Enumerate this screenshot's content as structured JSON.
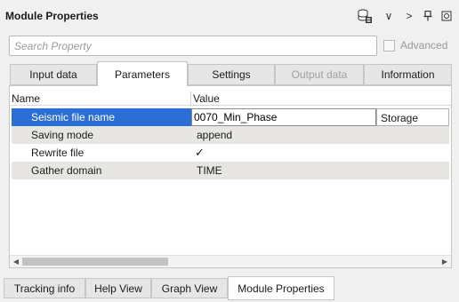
{
  "window": {
    "title": "Module Properties"
  },
  "toolbar": {
    "icons": [
      "database-icon",
      "chevron-down-icon",
      "chevron-right-icon",
      "pin-icon",
      "close-icon"
    ],
    "chevron_down": "∨",
    "chevron_right": ">",
    "pin": "⌇"
  },
  "search": {
    "placeholder": "Search Property"
  },
  "advanced": {
    "label": "Advanced",
    "checked": false
  },
  "tabs": [
    {
      "label": "Input data",
      "active": false,
      "disabled": false
    },
    {
      "label": "Parameters",
      "active": true,
      "disabled": false
    },
    {
      "label": "Settings",
      "active": false,
      "disabled": false
    },
    {
      "label": "Output data",
      "active": false,
      "disabled": true
    },
    {
      "label": "Information",
      "active": false,
      "disabled": false
    }
  ],
  "grid": {
    "columns": [
      "Name",
      "Value"
    ],
    "rows": [
      {
        "name": "Seismic file name",
        "value": "0070_Min_Phase",
        "extra": "Storage name",
        "selected": true
      },
      {
        "name": "Saving mode",
        "value": "append"
      },
      {
        "name": "Rewrite file",
        "value": "✓",
        "type": "checkbox"
      },
      {
        "name": "Gather domain",
        "value": "TIME"
      }
    ]
  },
  "bottom_tabs": [
    {
      "label": "Tracking info",
      "active": false
    },
    {
      "label": "Help View",
      "active": false
    },
    {
      "label": "Graph View",
      "active": false
    },
    {
      "label": "Module Properties",
      "active": true
    }
  ],
  "colors": {
    "selection": "#2b6fd6",
    "alt_row": "#e8e6e3"
  }
}
